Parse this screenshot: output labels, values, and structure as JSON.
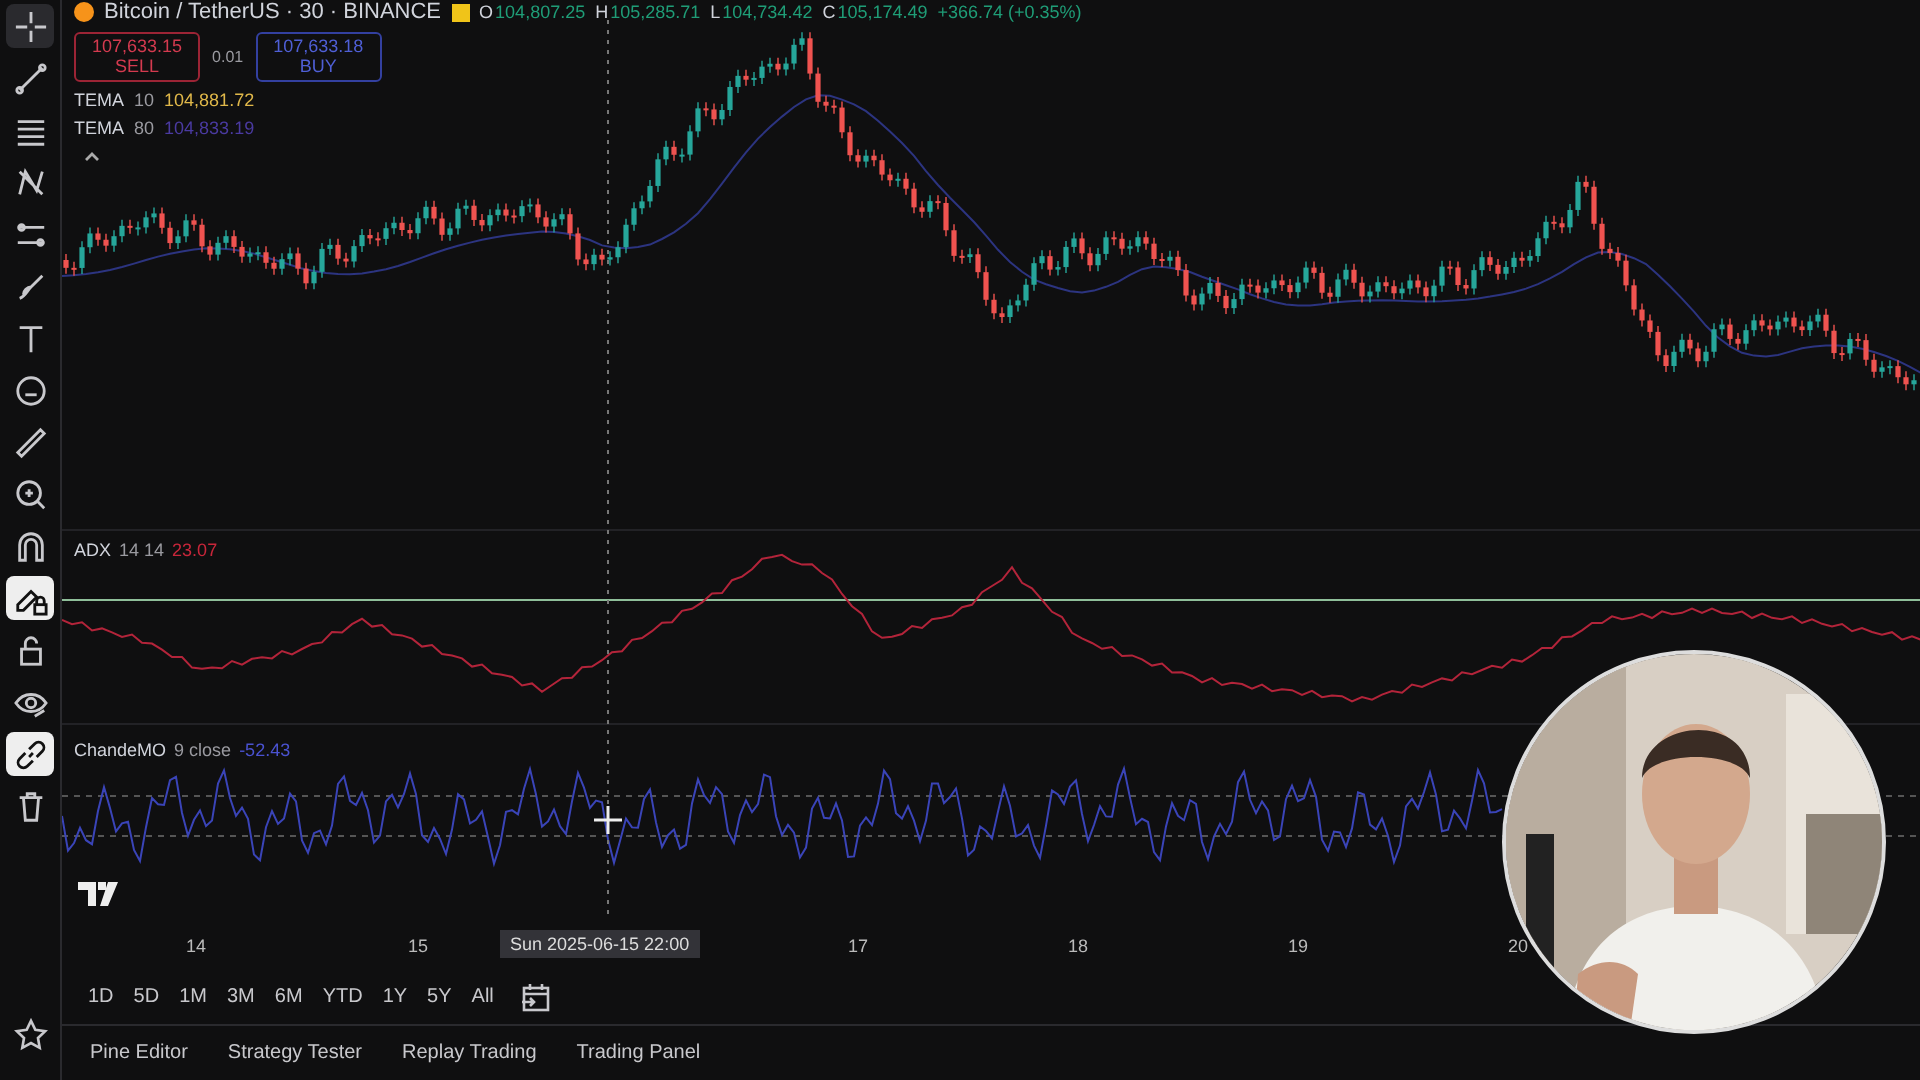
{
  "toolbar": [
    {
      "kind": "crosshair",
      "selected": false
    },
    {
      "kind": "line",
      "selected": false
    },
    {
      "kind": "fib",
      "selected": false
    },
    {
      "kind": "pattern",
      "selected": false
    },
    {
      "kind": "channel",
      "selected": false
    },
    {
      "kind": "brush",
      "selected": false
    },
    {
      "kind": "text",
      "selected": false
    },
    {
      "kind": "smiley",
      "selected": false
    },
    {
      "kind": "ruler",
      "selected": false
    },
    {
      "kind": "zoom",
      "selected": false
    },
    {
      "kind": "magnet",
      "selected": false
    },
    {
      "kind": "lockpen",
      "selected": true
    },
    {
      "kind": "lock",
      "selected": false
    },
    {
      "kind": "eye",
      "selected": false
    },
    {
      "kind": "link",
      "selected": true
    },
    {
      "kind": "trash",
      "selected": false
    }
  ],
  "symbol": {
    "title": "Bitcoin / TetherUS · 30 · BINANCE",
    "ohlc": [
      {
        "label": "O",
        "value": "104,807.25"
      },
      {
        "label": "H",
        "value": "105,285.71"
      },
      {
        "label": "L",
        "value": "104,734.42"
      },
      {
        "label": "C",
        "value": "105,174.49"
      }
    ],
    "change": "+366.74 (+0.35%)"
  },
  "order": {
    "sell_price": "107,633.15",
    "sell_label": "SELL",
    "spread": "0.01",
    "buy_price": "107,633.18",
    "buy_label": "BUY"
  },
  "indicators": [
    {
      "name": "TEMA",
      "params": "10",
      "value": "104,881.72",
      "color": "#e0b84a"
    },
    {
      "name": "TEMA",
      "params": "80",
      "value": "104,833.19",
      "color": "#4a3aa0"
    }
  ],
  "adx": {
    "name": "ADX",
    "params": "14 14",
    "value": "23.07"
  },
  "cmo": {
    "name": "ChandeMO",
    "params": "9 close",
    "value": "-52.43"
  },
  "time_axis": {
    "labels": [
      "14",
      "15",
      "17",
      "18",
      "19",
      "20"
    ],
    "cursor_label": "Sun 2025-06-15   22:00"
  },
  "ranges": [
    "1D",
    "5D",
    "1M",
    "3M",
    "6M",
    "YTD",
    "1Y",
    "5Y",
    "All"
  ],
  "bottom_tabs": [
    "Pine Editor",
    "Strategy Tester",
    "Replay Trading",
    "Trading Panel"
  ]
}
